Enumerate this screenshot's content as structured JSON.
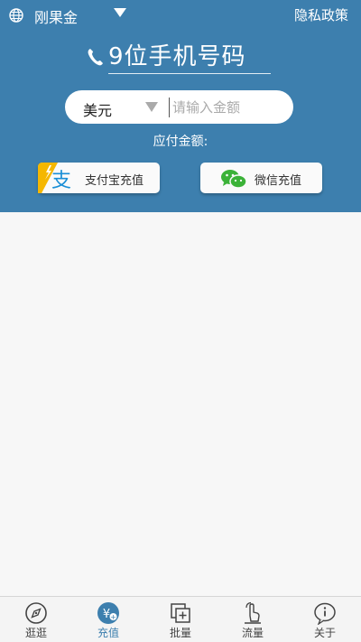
{
  "topbar": {
    "country": "刚果金",
    "privacy": "隐私政策"
  },
  "phone": {
    "placeholder": "9位手机号码"
  },
  "amount": {
    "currency": "美元",
    "placeholder": "请输入金额"
  },
  "pay_label": "应付金额:",
  "buttons": {
    "alipay": "支付宝充值",
    "wechat": "微信充值"
  },
  "tabs": [
    {
      "label": "逛逛",
      "icon": "compass-icon"
    },
    {
      "label": "充值",
      "icon": "recharge-icon",
      "active": true
    },
    {
      "label": "批量",
      "icon": "batch-add-icon"
    },
    {
      "label": "流量",
      "icon": "data-traffic-icon"
    },
    {
      "label": "关于",
      "icon": "info-icon"
    }
  ],
  "colors": {
    "brand": "#3d7fae",
    "alipay": "#1a8fd6",
    "wechat": "#3bb238",
    "alipay_badge": "#f5b700"
  }
}
